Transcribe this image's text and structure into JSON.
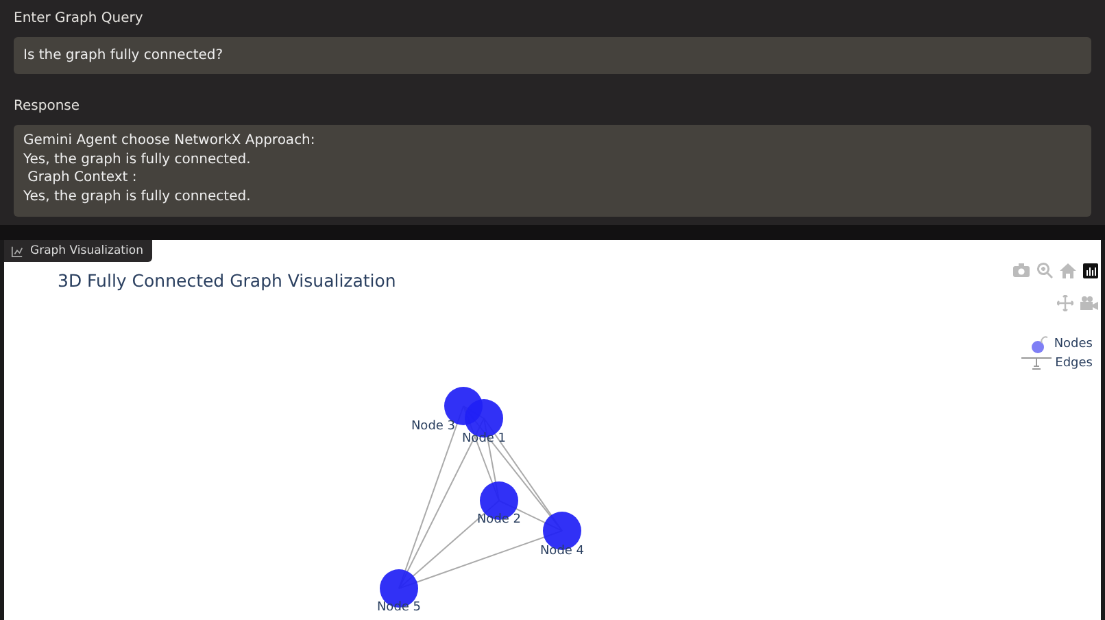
{
  "query": {
    "label": "Enter Graph Query",
    "value": "Is the graph fully connected?"
  },
  "response": {
    "label": "Response",
    "lines": [
      "Gemini Agent choose NetworkX Approach:",
      "Yes, the graph is fully connected.",
      " Graph Context :",
      "Yes, the graph is fully connected."
    ]
  },
  "plot_tab": {
    "label": "Graph Visualization"
  },
  "plot": {
    "title": "3D Fully Connected Graph Visualization",
    "nodes": [
      {
        "label": "Node 3"
      },
      {
        "label": "Node 1"
      },
      {
        "label": "Node 2"
      },
      {
        "label": "Node 4"
      },
      {
        "label": "Node 5"
      }
    ],
    "legend": [
      {
        "kind": "nodes",
        "label": "Nodes"
      },
      {
        "kind": "edges",
        "label": "Edges"
      }
    ]
  }
}
